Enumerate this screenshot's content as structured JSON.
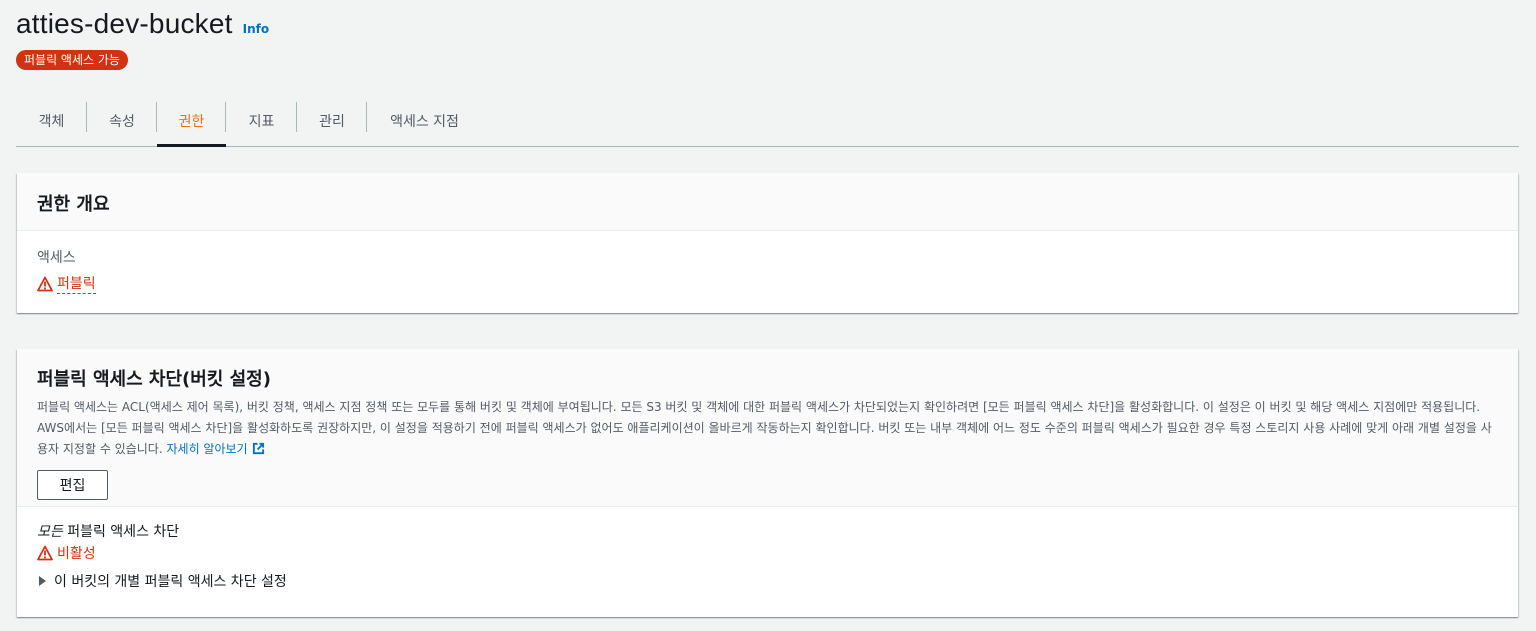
{
  "header": {
    "bucket_name": "atties-dev-bucket",
    "info_link": "Info",
    "badge": "퍼블릭 액세스 가능"
  },
  "tabs": [
    {
      "label": "객체",
      "active": false
    },
    {
      "label": "속성",
      "active": false
    },
    {
      "label": "권한",
      "active": true
    },
    {
      "label": "지표",
      "active": false
    },
    {
      "label": "관리",
      "active": false
    },
    {
      "label": "액세스 지점",
      "active": false
    }
  ],
  "overview": {
    "title": "권한 개요",
    "access_label": "액세스",
    "access_value": "퍼블릭"
  },
  "block_public_access": {
    "title": "퍼블릭 액세스 차단(버킷 설정)",
    "description": "퍼블릭 액세스는 ACL(액세스 제어 목록), 버킷 정책, 액세스 지점 정책 또는 모두를 통해 버킷 및 객체에 부여됩니다. 모든 S3 버킷 및 객체에 대한 퍼블릭 액세스가 차단되었는지 확인하려면 [모든 퍼블릭 액세스 차단]을 활성화합니다. 이 설정은 이 버킷 및 해당 액세스 지점에만 적용됩니다. AWS에서는 [모든 퍼블릭 액세스 차단]을 활성화하도록 권장하지만, 이 설정을 적용하기 전에 퍼블릭 액세스가 없어도 애플리케이션이 올바르게 작동하는지 확인합니다. 버킷 또는 내부 객체에 어느 정도 수준의 퍼블릭 액세스가 필요한 경우 특정 스토리지 사용 사례에 맞게 아래 개별 설정을 사용자 지정할 수 있습니다.",
    "learn_more": "자세히 알아보기",
    "edit_button": "편집",
    "setting_title_italic": "모든",
    "setting_title_rest": " 퍼블릭 액세스 차단",
    "setting_status": "비활성",
    "expander_label": "이 버킷의 개별 퍼블릭 액세스 차단 설정"
  },
  "colors": {
    "warning": "#d13212",
    "active_tab": "#ec7211",
    "link": "#0073bb"
  }
}
